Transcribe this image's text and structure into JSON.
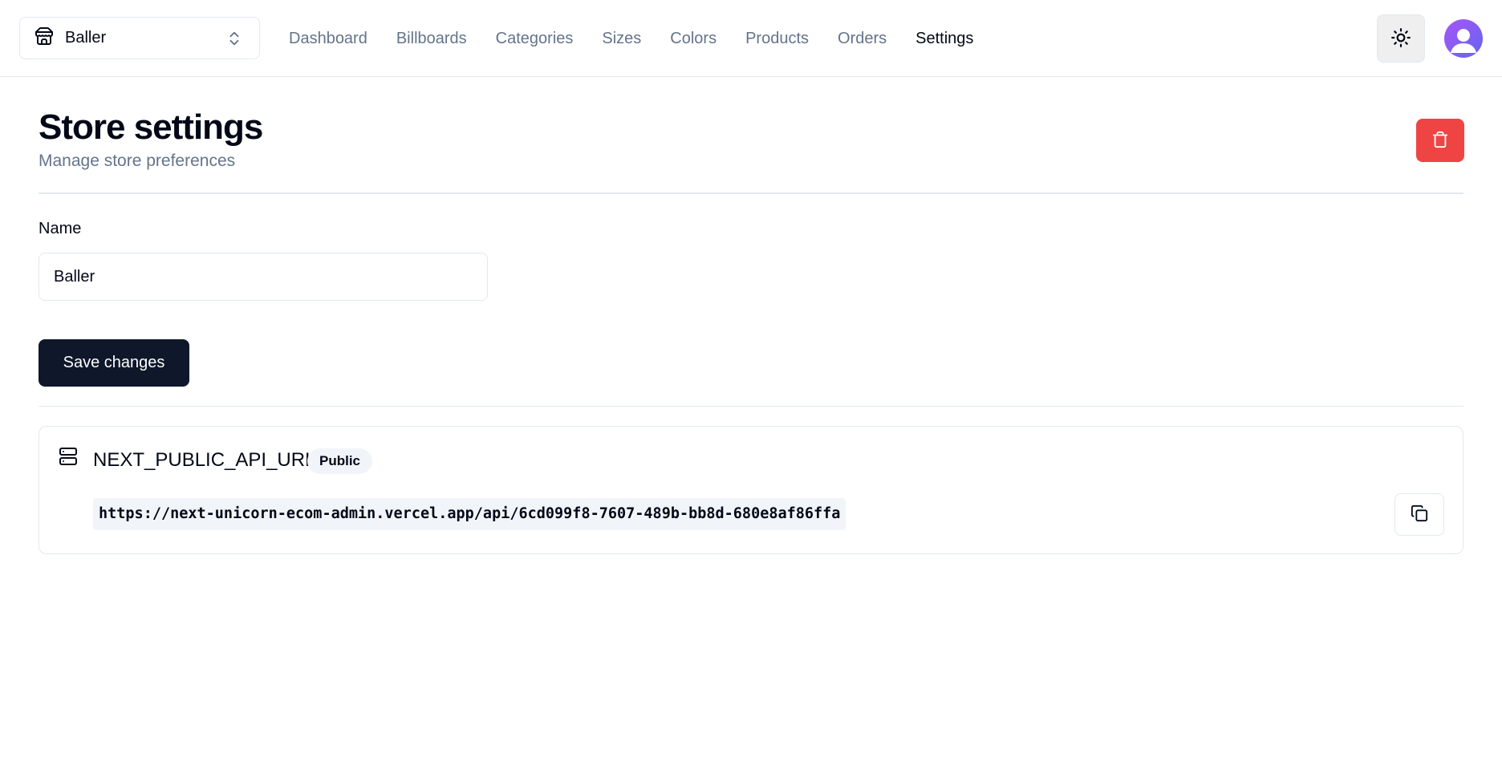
{
  "header": {
    "store_switcher": {
      "selected": "Baller",
      "icon": "store-icon"
    },
    "nav": [
      {
        "label": "Dashboard",
        "active": false
      },
      {
        "label": "Billboards",
        "active": false
      },
      {
        "label": "Categories",
        "active": false
      },
      {
        "label": "Sizes",
        "active": false
      },
      {
        "label": "Colors",
        "active": false
      },
      {
        "label": "Products",
        "active": false
      },
      {
        "label": "Orders",
        "active": false
      },
      {
        "label": "Settings",
        "active": true
      }
    ],
    "theme_icon": "sun-icon"
  },
  "page": {
    "title": "Store settings",
    "subtitle": "Manage store preferences",
    "delete_icon": "trash-icon"
  },
  "form": {
    "name_label": "Name",
    "name_value": "Baller",
    "save_label": "Save changes"
  },
  "api_card": {
    "key": "NEXT_PUBLIC_API_URL",
    "badge": "Public",
    "value": "https://next-unicorn-ecom-admin.vercel.app/api/6cd099f8-7607-489b-bb8d-680e8af86ffa"
  },
  "colors": {
    "danger": "#ef4444",
    "primary": "#0f172a",
    "muted": "#64748b"
  }
}
